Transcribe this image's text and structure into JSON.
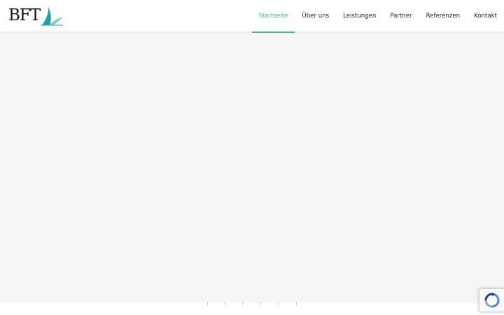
{
  "brand": {
    "logo_text": "BFT",
    "accent_color": "#3cbf93",
    "logo_mark_colors": [
      "#1aa3a8",
      "#7ed3c4"
    ]
  },
  "nav": {
    "items": [
      {
        "label": "Startseite",
        "active": true
      },
      {
        "label": "Über uns",
        "active": false
      },
      {
        "label": "Leistungen",
        "active": false
      },
      {
        "label": "Partner",
        "active": false
      },
      {
        "label": "Referenzen",
        "active": false
      },
      {
        "label": "Kontakt",
        "active": false
      }
    ]
  },
  "hero": {
    "background": "#f6f6f6",
    "slide_count": 6
  },
  "recaptcha": {
    "icon": "recaptcha-icon"
  }
}
